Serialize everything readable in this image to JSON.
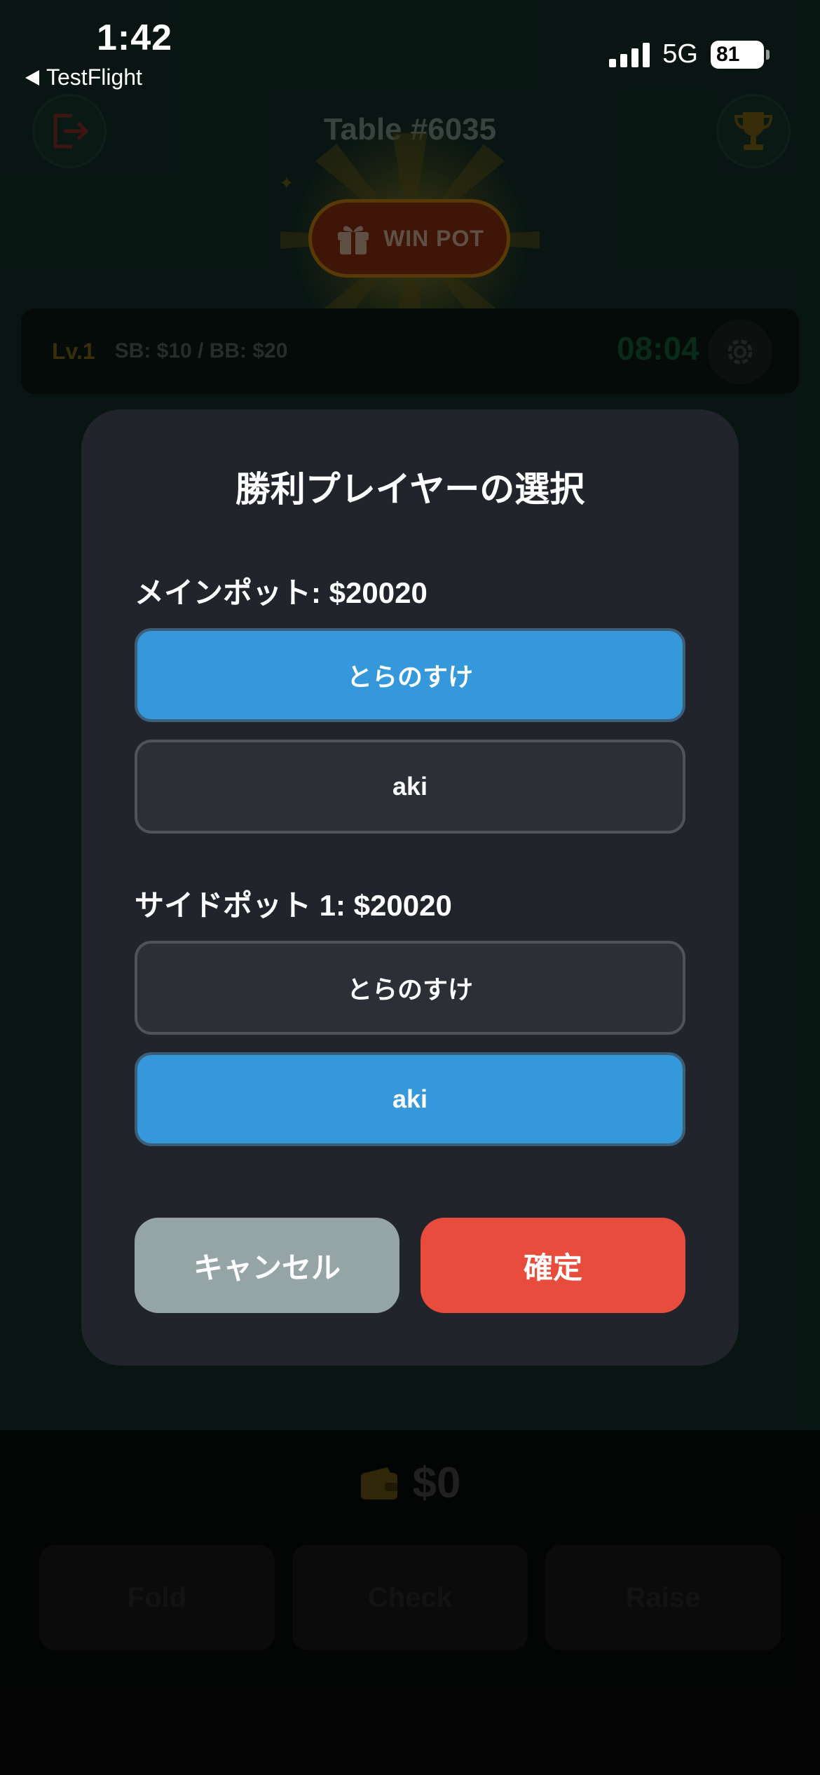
{
  "status_bar": {
    "time": "1:42",
    "back_app": "TestFlight",
    "network": "5G",
    "battery": "81"
  },
  "game": {
    "table_title": "Table #6035",
    "win_pot_label": "WIN POT",
    "level": "Lv.1",
    "blinds": "SB: $10 / BB: $20",
    "timer": "08:04",
    "wallet_amount": "$0",
    "actions": {
      "fold": "Fold",
      "check": "Check",
      "raise": "Raise"
    },
    "colors": {
      "felt": "#102a23",
      "exit_icon": "#7a2a26",
      "trophy_icon": "#6b5612",
      "timer": "#145232"
    }
  },
  "modal": {
    "title": "勝利プレイヤーの選択",
    "main_pot": {
      "label": "メインポット: $20020",
      "players": [
        {
          "name": "とらのすけ",
          "selected": true
        },
        {
          "name": "aki",
          "selected": false
        }
      ]
    },
    "side_pot": {
      "label": "サイドポット 1: $20020",
      "players": [
        {
          "name": "とらのすけ",
          "selected": false
        },
        {
          "name": "aki",
          "selected": true
        }
      ]
    },
    "cancel_label": "キャンセル",
    "confirm_label": "確定",
    "colors": {
      "selected": "#3598db",
      "unselected": "#2c2f36",
      "cancel": "#95a5a6",
      "confirm": "#e74c3c",
      "panel": "#21242b"
    }
  }
}
